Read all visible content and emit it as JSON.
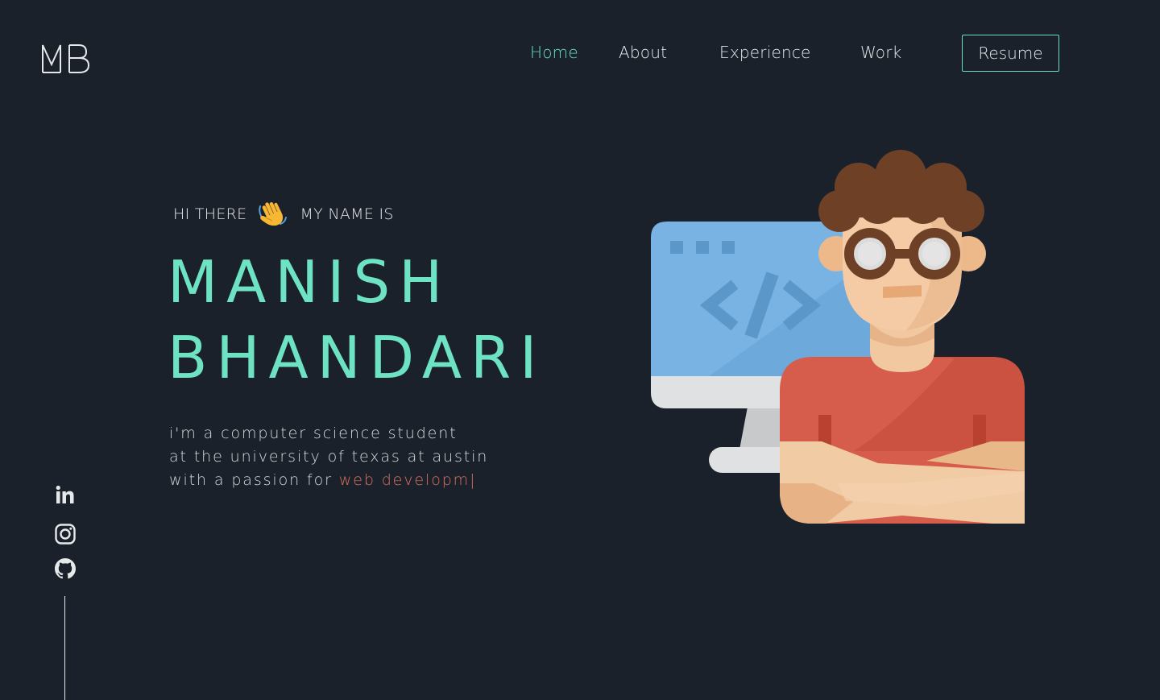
{
  "brand": {
    "logo_text": "MB"
  },
  "nav": {
    "items": [
      {
        "label": "Home",
        "active": true
      },
      {
        "label": "About",
        "active": false
      },
      {
        "label": "Experience",
        "active": false
      },
      {
        "label": "Work",
        "active": false
      }
    ],
    "resume_label": "Resume"
  },
  "hero": {
    "greeting_start": "HI THERE",
    "greeting_end": "MY NAME IS",
    "wave_icon": "waving-hand-icon",
    "first_name": "MANISH",
    "last_name": "BHANDARI",
    "tagline_line1": "i'm a computer science student",
    "tagline_line2": "at the university of texas at austin",
    "tagline_line3_prefix": "with a passion for ",
    "tagline_typed": "web developm|"
  },
  "social": {
    "icons": [
      "linkedin-icon",
      "instagram-icon",
      "github-icon"
    ]
  },
  "colors": {
    "background": "#1b212a",
    "accent": "#64e0c0",
    "text": "#e6e8ea",
    "typed": "#d9715e"
  }
}
